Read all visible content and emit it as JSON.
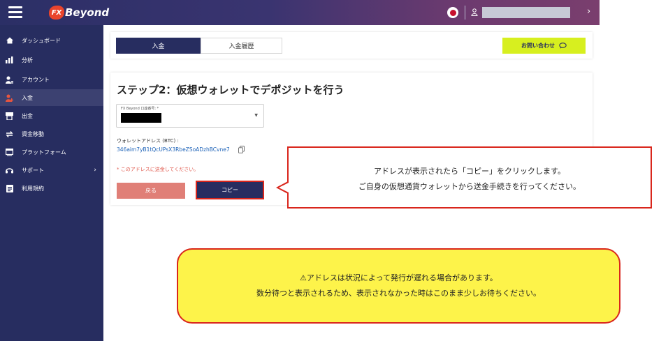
{
  "brand": {
    "logo_mark": "FX",
    "logo_text": "Beyond"
  },
  "topbar": {
    "flag": "japan-flag",
    "chevron": "›"
  },
  "sidebar": {
    "items": [
      {
        "label": "ダッシュボード",
        "icon": "home-icon"
      },
      {
        "label": "分析",
        "icon": "analytics-icon"
      },
      {
        "label": "アカウント",
        "icon": "account-icon"
      },
      {
        "label": "入金",
        "icon": "deposit-icon",
        "active": true
      },
      {
        "label": "出金",
        "icon": "withdraw-icon"
      },
      {
        "label": "資金移動",
        "icon": "transfer-icon"
      },
      {
        "label": "プラットフォーム",
        "icon": "platform-icon"
      },
      {
        "label": "サポート",
        "icon": "support-icon",
        "chevron": "›"
      },
      {
        "label": "利用規約",
        "icon": "terms-icon"
      }
    ]
  },
  "tabs": {
    "deposit": "入金",
    "history": "入金履歴"
  },
  "contact": {
    "label": "お問い合わせ"
  },
  "main": {
    "title": "ステップ2：仮想ウォレットでデポジットを行う",
    "account_label": "FX Beyond 口座番号: *",
    "wallet_label": "ウォレットアドレス (BTC) :",
    "wallet_address": "346aim7yB1tQcUPsX3RbeZSoADzhBCvne7",
    "warning": "* このアドレスに送金してください。",
    "back_label": "戻る",
    "copy_label": "コピー"
  },
  "callout": {
    "line1": "アドレスが表示されたら「コピー」をクリックします。",
    "line2": "ご自身の仮想通貨ウォレットから送金手続きを行ってください。"
  },
  "notice": {
    "line1": "⚠アドレスは状況によって発行が遅れる場合があります。",
    "line2": "数分待つと表示されるため、表示されなかった時はこのまま少しお待ちください。"
  },
  "colors": {
    "sidebar": "#272d60",
    "accent_red": "#d9261c",
    "contact_yellow": "#d7ef1f",
    "notice_yellow": "#fdf34a",
    "link_blue": "#1e63b8"
  }
}
